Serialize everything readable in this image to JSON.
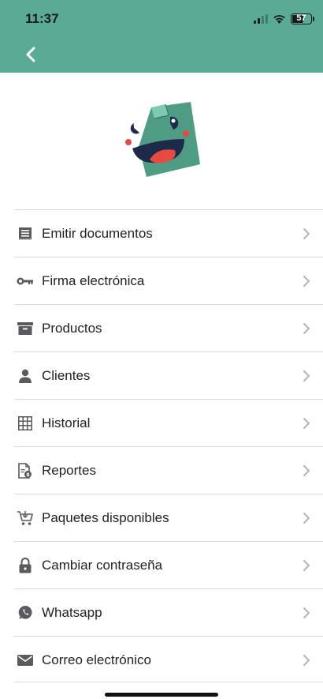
{
  "status_bar": {
    "time": "11:37",
    "battery_level": "57"
  },
  "header": {
    "background_color": "#5aab95",
    "back_icon": "chevron-left-icon"
  },
  "menu": {
    "items": [
      {
        "label": "Emitir documentos",
        "icon": "receipt-icon"
      },
      {
        "label": "Firma electrónica",
        "icon": "key-icon"
      },
      {
        "label": "Productos",
        "icon": "archive-box-icon"
      },
      {
        "label": "Clientes",
        "icon": "person-icon"
      },
      {
        "label": "Historial",
        "icon": "grid-table-icon"
      },
      {
        "label": "Reportes",
        "icon": "report-dollar-icon"
      },
      {
        "label": "Paquetes disponibles",
        "icon": "cart-icon"
      },
      {
        "label": "Cambiar contraseña",
        "icon": "lock-icon"
      },
      {
        "label": "Whatsapp",
        "icon": "whatsapp-icon"
      },
      {
        "label": "Correo electrónico",
        "icon": "mail-icon"
      }
    ]
  }
}
